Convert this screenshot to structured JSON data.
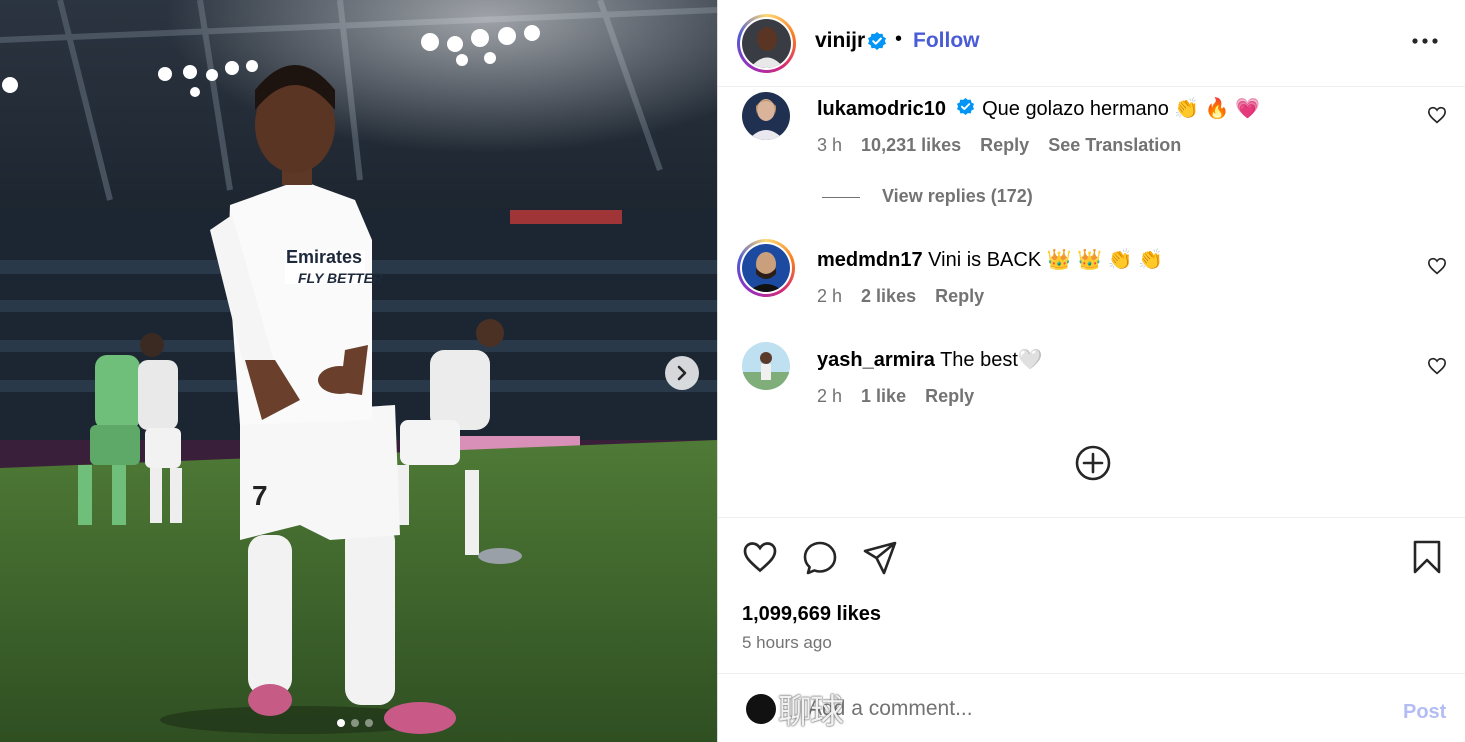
{
  "post": {
    "author": {
      "username": "vinijr",
      "verified": true
    },
    "separator": "•",
    "follow_label": "Follow",
    "more_icon": "more-options-icon",
    "carousel": {
      "total_slides": 3,
      "current_slide": 1
    },
    "likes": "1,099,669 likes",
    "time_ago": "5 hours ago"
  },
  "comments": [
    {
      "username": "lukamodric10",
      "verified": true,
      "text": "Que golazo hermano 👏 🔥 💗",
      "time": "3 h",
      "likes": "10,231 likes",
      "reply_label": "Reply",
      "translation_label": "See Translation"
    },
    {
      "username": "medmdn17",
      "verified": false,
      "text": "Vini is BACK 👑 👑 👏 👏",
      "time": "2 h",
      "likes": "2 likes",
      "reply_label": "Reply"
    },
    {
      "username": "yash_armira",
      "verified": false,
      "text": "The best🤍",
      "time": "2 h",
      "likes": "1 like",
      "reply_label": "Reply"
    }
  ],
  "view_replies_label": "View replies (172)",
  "comment_box": {
    "placeholder": "Add a comment...",
    "post_label": "Post",
    "watermark": "聊球"
  },
  "colors": {
    "link_blue": "#4a5bd6",
    "verified_blue": "#0095f6",
    "secondary_text": "#737373",
    "post_disabled": "#b3bdf4"
  }
}
